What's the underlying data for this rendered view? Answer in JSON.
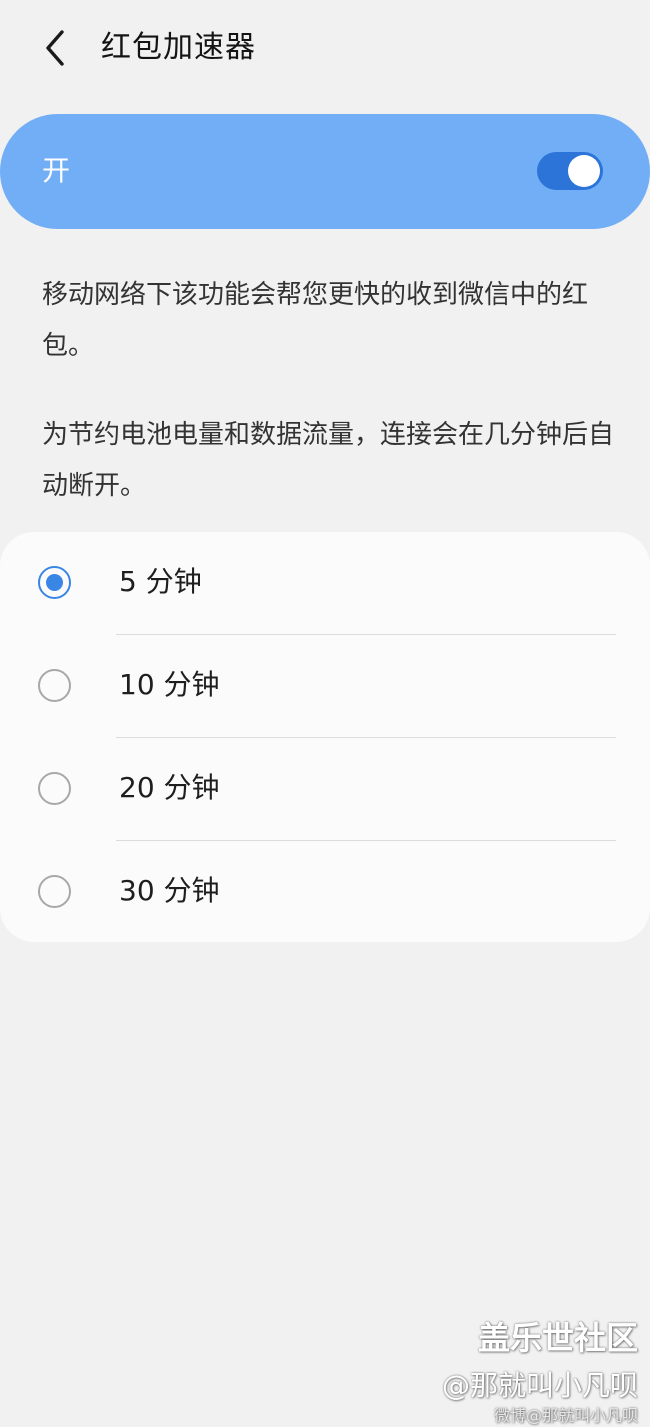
{
  "header": {
    "title": "红包加速器",
    "back_icon": "chevron-left-icon"
  },
  "master_switch": {
    "label": "开",
    "checked": true,
    "bg_color": "#71aef6",
    "track_color": "#2d74d9"
  },
  "descriptions": [
    "移动网络下该功能会帮您更快的收到微信中的红包。",
    "为节约电池电量和数据流量，连接会在几分钟后自动断开。"
  ],
  "options": [
    {
      "label": "5 分钟",
      "selected": true
    },
    {
      "label": "10 分钟",
      "selected": false
    },
    {
      "label": "20 分钟",
      "selected": false
    },
    {
      "label": "30 分钟",
      "selected": false
    }
  ],
  "accent_color": "#3a86e4",
  "watermark": {
    "line1": "盖乐世社区",
    "line2": "@那就叫小凡呗",
    "line3": "微博@那就叫小凡呗"
  }
}
